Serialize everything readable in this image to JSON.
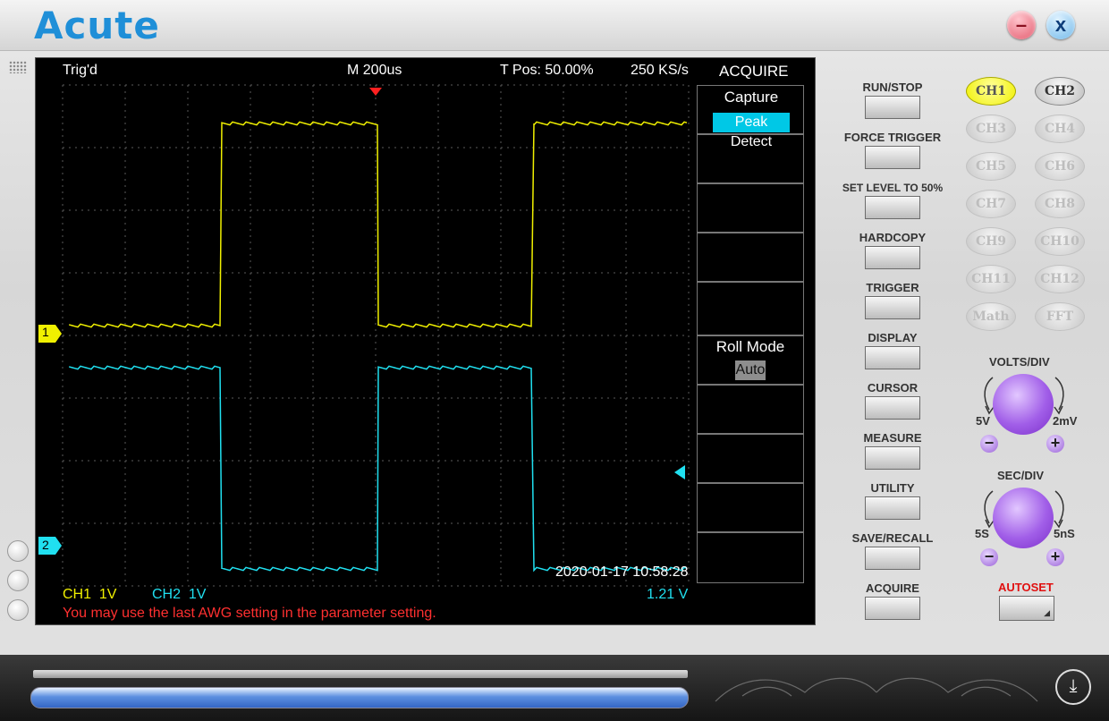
{
  "app": {
    "title": "Acute"
  },
  "window": {
    "minimize_icon": "–",
    "close_icon": "x"
  },
  "screen": {
    "trig_status": "Trig'd",
    "timebase": "M 200us",
    "tpos": "T Pos: 50.00%",
    "sample_rate": "250 KS/s",
    "ch1_marker": "1",
    "ch2_marker": "2",
    "ch1_label": "CH1",
    "ch1_scale": "1V",
    "ch2_label": "CH2",
    "ch2_scale": "1V",
    "timestamp": "2020-01-17 10:58:28",
    "trigger_level": "1.21 V",
    "message": "You may use the last AWG setting in the parameter setting.",
    "colors": {
      "ch1": "#f0f000",
      "ch2": "#20e0f0",
      "message": "#ff3030",
      "trigger": "#ff2020"
    }
  },
  "acquire_menu": {
    "title": "ACQUIRE",
    "capture_label": "Capture",
    "capture_value": "Peak Detect",
    "roll_label": "Roll Mode",
    "roll_value": "Auto"
  },
  "controls": {
    "run_stop": "RUN/STOP",
    "force_trigger": "FORCE TRIGGER",
    "set_level": "SET LEVEL TO 50%",
    "hardcopy": "HARDCOPY",
    "trigger": "TRIGGER",
    "display": "DISPLAY",
    "cursor": "CURSOR",
    "measure": "MEASURE",
    "utility": "UTILITY",
    "save_recall": "SAVE/RECALL",
    "acquire": "ACQUIRE",
    "autoset": "AUTOSET"
  },
  "channels": [
    "CH1",
    "CH2",
    "CH3",
    "CH4",
    "CH5",
    "CH6",
    "CH7",
    "CH8",
    "CH9",
    "CH10",
    "CH11",
    "CH12",
    "Math",
    "FFT"
  ],
  "volts_div": {
    "title": "VOLTS/DIV",
    "min": "5V",
    "max": "2mV",
    "minus": "−",
    "plus": "+"
  },
  "sec_div": {
    "title": "SEC/DIV",
    "min": "5S",
    "max": "5nS",
    "minus": "−",
    "plus": "+"
  }
}
